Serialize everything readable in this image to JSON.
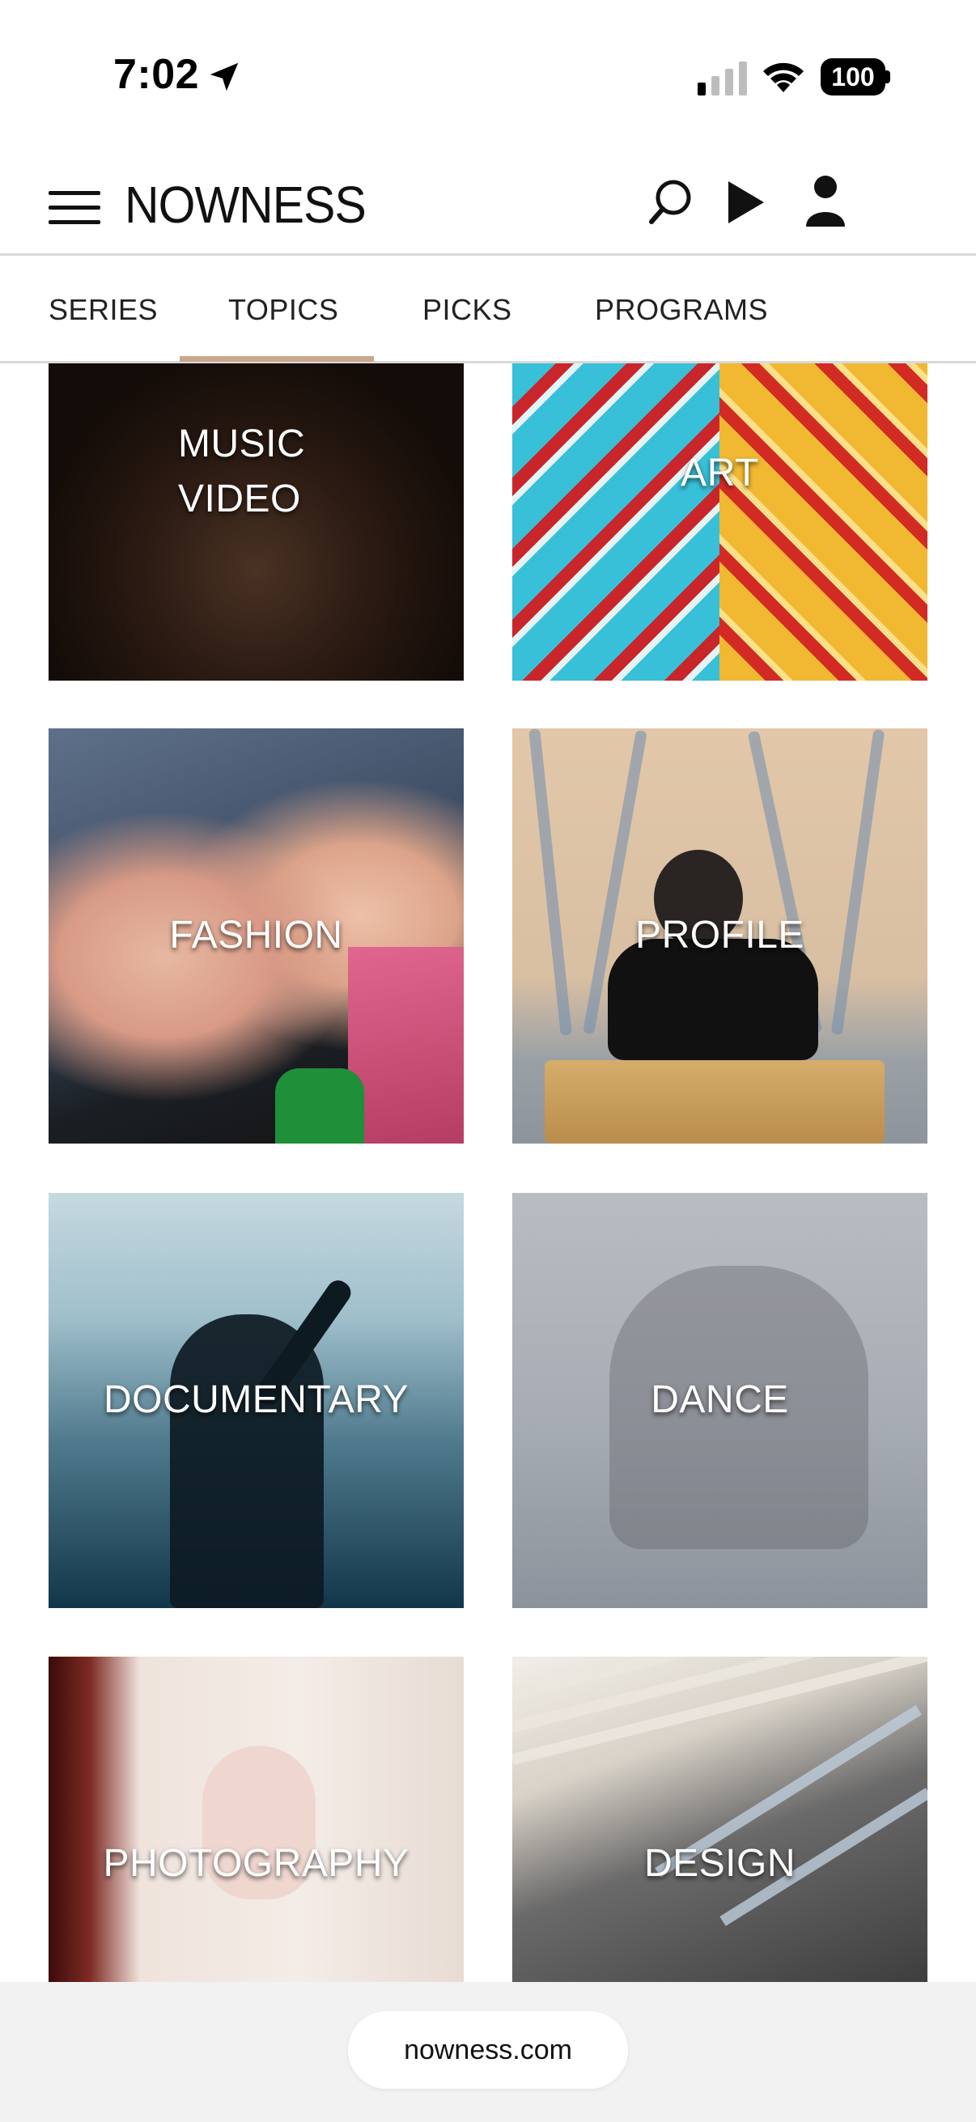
{
  "status_bar": {
    "time": "7:02",
    "battery": "100"
  },
  "header": {
    "logo": "NOWNESS",
    "icons": [
      "menu-icon",
      "search-icon",
      "play-icon",
      "user-icon"
    ]
  },
  "tabs": [
    {
      "label": "SERIES",
      "active": false
    },
    {
      "label": "TOPICS",
      "active": true
    },
    {
      "label": "PICKS",
      "active": false
    },
    {
      "label": "PROGRAMS",
      "active": false
    }
  ],
  "accent_color": "#c9a88c",
  "topics": [
    {
      "line1": "MUSIC",
      "line2": "VIDEO"
    },
    {
      "label": "ART"
    },
    {
      "label": "FASHION"
    },
    {
      "label": "PROFILE"
    },
    {
      "label": "DOCUMENTARY"
    },
    {
      "label": "DANCE"
    },
    {
      "label": "PHOTOGRAPHY"
    },
    {
      "label": "DESIGN"
    }
  ],
  "browser": {
    "url": "nowness.com"
  }
}
